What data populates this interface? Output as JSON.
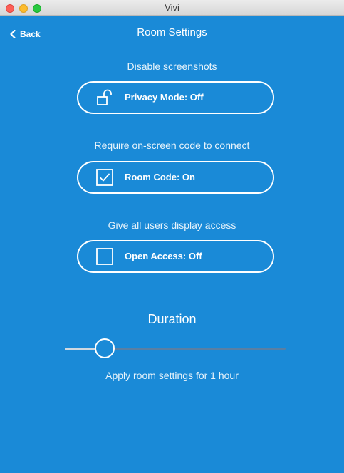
{
  "window": {
    "title": "Vivi"
  },
  "nav": {
    "back_label": "Back",
    "title": "Room Settings"
  },
  "settings": [
    {
      "description": "Disable screenshots",
      "button_label": "Privacy Mode: Off",
      "icon": "unlocked-padlock-icon",
      "state": "off"
    },
    {
      "description": "Require on-screen code to connect",
      "button_label": "Room Code: On",
      "icon": "checked-checkbox-icon",
      "state": "on"
    },
    {
      "description": "Give all users display access",
      "button_label": "Open Access: Off",
      "icon": "empty-checkbox-icon",
      "state": "off"
    }
  ],
  "duration": {
    "title": "Duration",
    "slider_fraction": 0.18,
    "caption": "Apply room settings for 1 hour"
  },
  "colors": {
    "background": "#1a8ad7",
    "foreground": "#ffffff",
    "track": "#5a7fa3"
  }
}
